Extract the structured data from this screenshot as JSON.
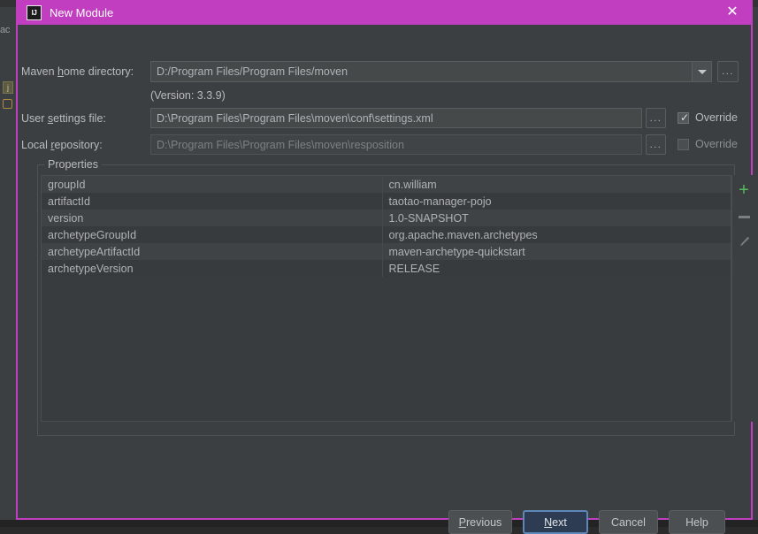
{
  "window": {
    "title": "New Module",
    "icon_name": "intellij-idea-icon",
    "icon_glyph": "IJ",
    "close_glyph": "✕",
    "titlebar_color": "#c13ec1"
  },
  "fields": {
    "maven_home": {
      "label_pre": "Maven ",
      "label_mnemonic": "h",
      "label_post": "ome directory:",
      "value": "D:/Program Files/Program Files/moven",
      "dropdown_icon": "chevron-down-icon",
      "browse_label": "..."
    },
    "version_note": "(Version: 3.3.9)",
    "user_settings": {
      "label_pre": "User ",
      "label_mnemonic": "s",
      "label_post": "ettings file:",
      "value": "D:\\Program Files\\Program Files\\moven\\conf\\settings.xml",
      "browse_label": "...",
      "override_label": "Override",
      "override_checked": true,
      "check_glyph": "✓"
    },
    "local_repository": {
      "label_pre": "Local ",
      "label_mnemonic": "r",
      "label_post": "epository:",
      "value": "D:\\Program Files\\Program Files\\moven\\resposition",
      "browse_label": "...",
      "override_label": "Override",
      "override_checked": false,
      "disabled": true
    }
  },
  "properties": {
    "group_title": "Properties",
    "rows": [
      {
        "key": "groupId",
        "value": "cn.william"
      },
      {
        "key": "artifactId",
        "value": "taotao-manager-pojo"
      },
      {
        "key": "version",
        "value": "1.0-SNAPSHOT"
      },
      {
        "key": "archetypeGroupId",
        "value": "org.apache.maven.archetypes"
      },
      {
        "key": "archetypeArtifactId",
        "value": "maven-archetype-quickstart"
      },
      {
        "key": "archetypeVersion",
        "value": "RELEASE"
      }
    ],
    "toolbar": {
      "add_label": "+",
      "add_color": "#55b85d",
      "remove_name": "remove-property-button",
      "edit_name": "edit-property-button"
    }
  },
  "footer": {
    "previous": {
      "pre": "",
      "mnemonic": "P",
      "post": "revious"
    },
    "next": {
      "pre": "",
      "mnemonic": "N",
      "post": "ext"
    },
    "cancel": "Cancel",
    "help": "Help",
    "primary_border": "#5d87b9"
  },
  "background": {
    "ghost_text": "ac"
  }
}
